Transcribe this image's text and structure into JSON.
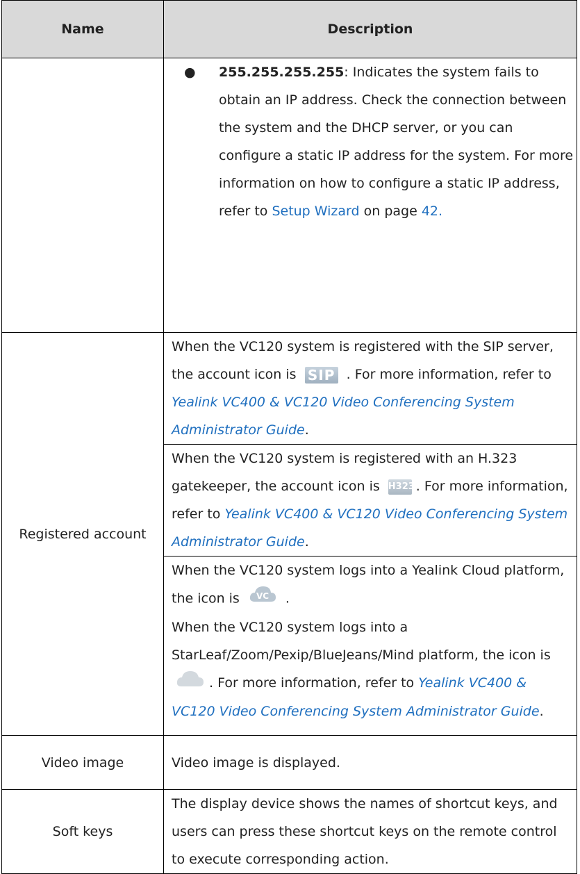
{
  "header": {
    "name": "Name",
    "description": "Description"
  },
  "row_ip": {
    "bullet": "●",
    "bold": "255.255.255.255",
    "text": ": Indicates the system fails to obtain an IP address. Check the connection between the system and the DHCP server, or you can configure a static IP address for the system. For more information on how to configure a static IP address, refer to ",
    "link": "Setup Wizard",
    "after_link": " on page ",
    "page": "42",
    "end": "."
  },
  "registered": {
    "name": "Registered account",
    "sip": {
      "text1": "When the VC120 system is registered with the SIP server, the account icon is ",
      "icon_text": "SIP",
      "text2": " . For more information, refer to ",
      "link": "Yealink VC400 & VC120 Video Conferencing System Administrator Guide",
      "end": "."
    },
    "h323": {
      "text1": "When the VC120 system is registered with an H.323 gatekeeper, the account icon is ",
      "icon_text": "H323",
      "text2": ". For more information, refer to ",
      "link": "Yealink VC400 & VC120 Video Conferencing System Administrator Guide",
      "end": "."
    },
    "cloud": {
      "text1": "When the VC120 system logs into a Yealink Cloud platform, the icon is ",
      "icon1_text": "VC",
      "text2": " .",
      "text3": "When the VC120 system logs into a StarLeaf/Zoom/Pexip/BlueJeans/Mind platform, the icon is ",
      "text4": ". For more information, refer to ",
      "link": "Yealink VC400 & VC120 Video Conferencing System Administrator Guide",
      "end": "."
    }
  },
  "video": {
    "name": "Video image",
    "desc": "Video image is displayed."
  },
  "softkeys": {
    "name": "Soft keys",
    "desc": "The display device shows the names of shortcut keys, and users can press these shortcut keys on the remote control to execute corresponding action."
  }
}
